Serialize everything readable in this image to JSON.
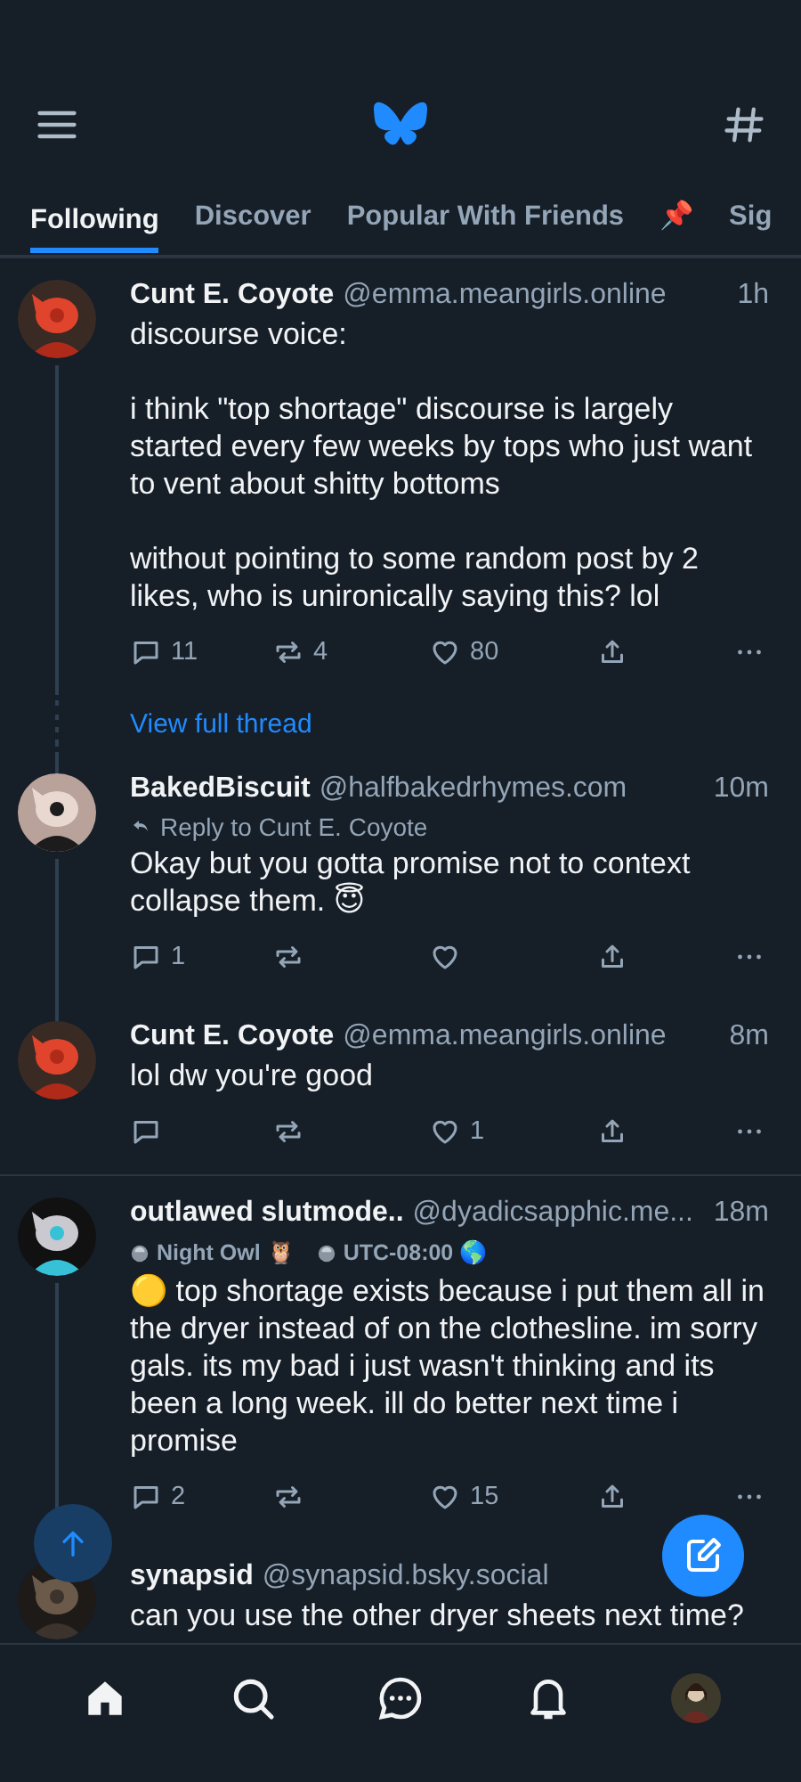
{
  "tabs": [
    {
      "label": "Following",
      "selected": true
    },
    {
      "label": "Discover",
      "selected": false
    },
    {
      "label": "Popular With Friends",
      "selected": false
    },
    {
      "label": "📌",
      "selected": false
    },
    {
      "label": "Sig",
      "selected": false
    }
  ],
  "feed": [
    {
      "kind": "post",
      "author": "Cunt E. Coyote",
      "handle": "@emma.meangirls.online",
      "time": "1h",
      "text": "discourse voice:\n\ni think \"top shortage\" discourse is largely started every few weeks by tops who just want to vent about shitty bottoms\n\nwithout pointing to some random post by 2 likes, who is unironically saying this? lol",
      "replies": "11",
      "reposts": "4",
      "likes": "80",
      "line_above": false,
      "line_below": true,
      "divider": true
    },
    {
      "kind": "view_thread",
      "label": "View full thread"
    },
    {
      "kind": "post",
      "author": "BakedBiscuit",
      "handle": "@halfbakedrhymes.com",
      "time": "10m",
      "reply_to": "Reply to Cunt E. Coyote",
      "text": "Okay but you gotta promise not to context collapse them. 😇",
      "replies": "1",
      "line_above": true,
      "line_below": true,
      "divider": false
    },
    {
      "kind": "post",
      "author": "Cunt E. Coyote",
      "handle": "@emma.meangirls.online",
      "time": "8m",
      "text": "lol dw you're good",
      "likes": "1",
      "line_above": true,
      "line_below": false,
      "divider": false
    },
    {
      "kind": "post",
      "author": "outlawed slutmode..",
      "handle": "@dyadicsapphic.me...",
      "time": "18m",
      "labels": [
        "Night Owl 🦉",
        "UTC-08:00 🌎"
      ],
      "text": "🟡 top shortage exists because i put them all in the dryer instead of on the clothesline. im sorry gals. its my bad i just wasn't thinking and its been a long week. ill do better next time i promise",
      "replies": "2",
      "likes": "15",
      "line_above": false,
      "line_below": true,
      "divider": true
    },
    {
      "kind": "post",
      "author": "synapsid",
      "handle": "@synapsid.bsky.social",
      "text": "can you use the other dryer sheets next time?",
      "line_above": true,
      "line_below": false,
      "divider": false
    }
  ],
  "nav": [
    {
      "kind": "home"
    },
    {
      "kind": "search"
    },
    {
      "kind": "chat"
    },
    {
      "kind": "bell"
    },
    {
      "kind": "profile"
    }
  ]
}
